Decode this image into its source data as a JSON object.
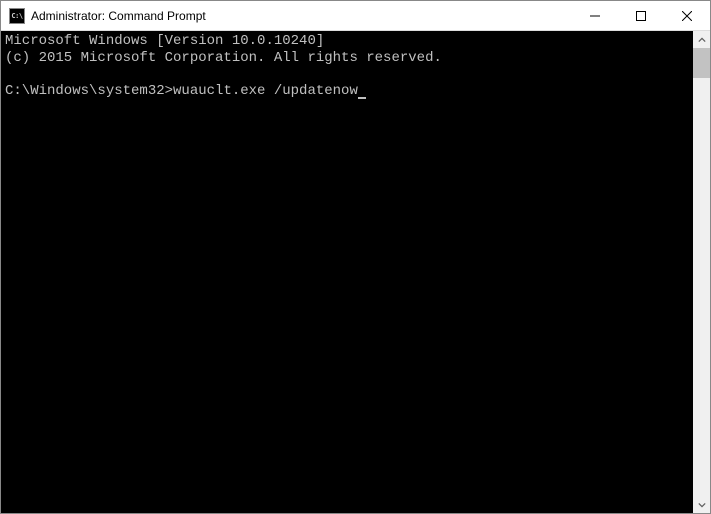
{
  "titlebar": {
    "icon_label": "C:\\",
    "title": "Administrator: Command Prompt"
  },
  "terminal": {
    "line1": "Microsoft Windows [Version 10.0.10240]",
    "line2": "(c) 2015 Microsoft Corporation. All rights reserved.",
    "blank": "",
    "prompt": "C:\\Windows\\system32>",
    "command": "wuauclt.exe /updatenow"
  }
}
